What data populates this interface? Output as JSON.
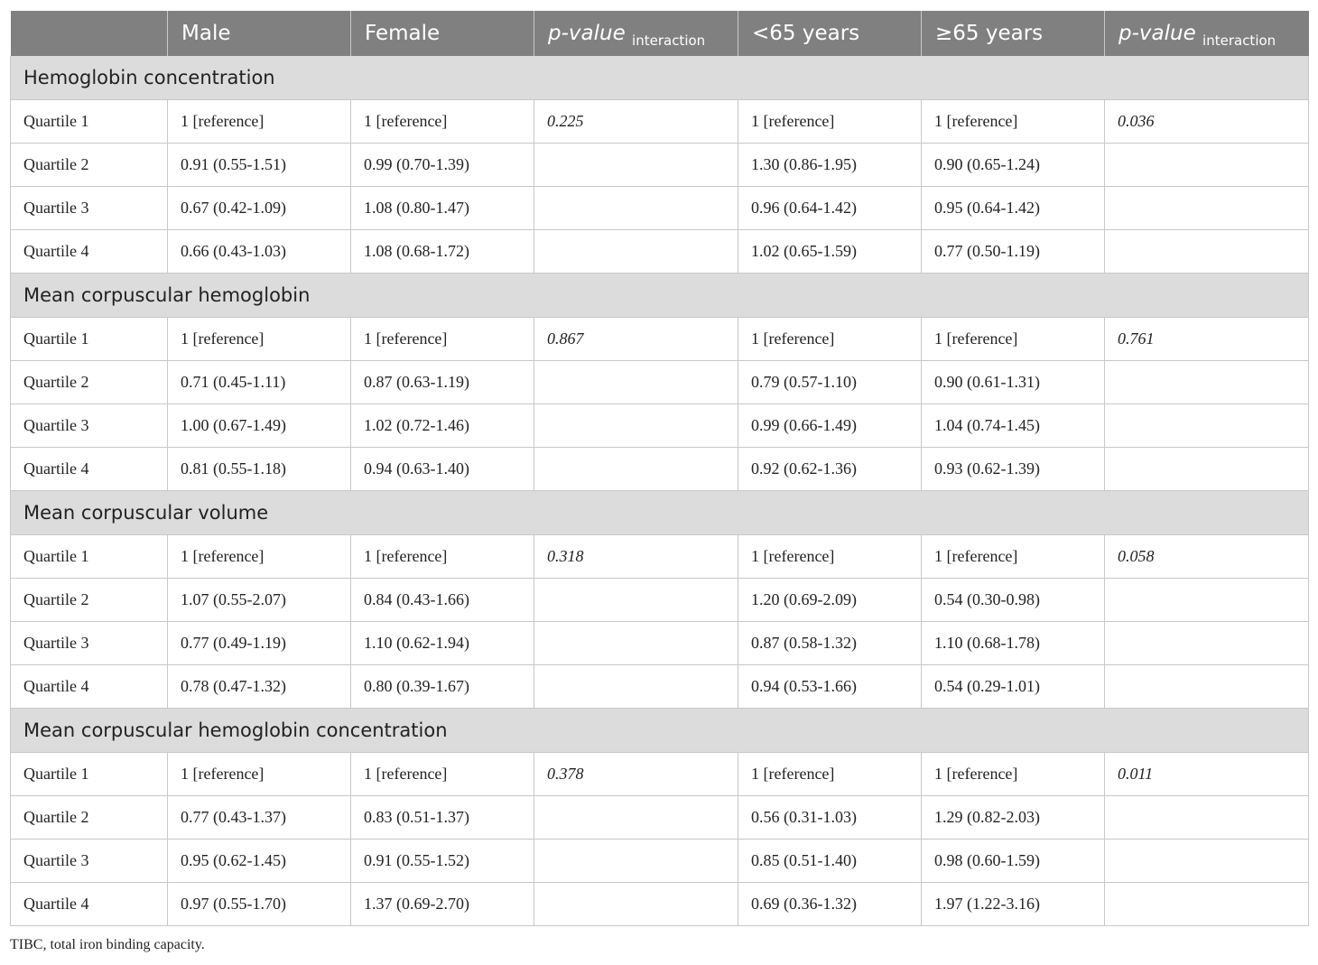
{
  "header": {
    "col0": "",
    "col1": "Male",
    "col2": "Female",
    "col3_main": "p-value",
    "col3_sub": "interaction",
    "col4": "<65 years",
    "col5": "≥65 years",
    "col6_main": "p-value",
    "col6_sub": "interaction"
  },
  "sections": [
    {
      "title": "Hemoglobin concentration",
      "rows": [
        [
          "Quartile 1",
          "1 [reference]",
          "1 [reference]",
          "0.225",
          "1 [reference]",
          "1 [reference]",
          "0.036"
        ],
        [
          "Quartile 2",
          "0.91 (0.55-1.51)",
          "0.99 (0.70-1.39)",
          "",
          "1.30 (0.86-1.95)",
          "0.90 (0.65-1.24)",
          ""
        ],
        [
          "Quartile 3",
          "0.67 (0.42-1.09)",
          "1.08 (0.80-1.47)",
          "",
          "0.96 (0.64-1.42)",
          "0.95 (0.64-1.42)",
          ""
        ],
        [
          "Quartile 4",
          "0.66 (0.43-1.03)",
          "1.08 (0.68-1.72)",
          "",
          "1.02 (0.65-1.59)",
          "0.77 (0.50-1.19)",
          ""
        ]
      ]
    },
    {
      "title": "Mean corpuscular hemoglobin",
      "rows": [
        [
          "Quartile 1",
          "1 [reference]",
          "1 [reference]",
          "0.867",
          "1 [reference]",
          "1 [reference]",
          "0.761"
        ],
        [
          "Quartile 2",
          "0.71 (0.45-1.11)",
          "0.87 (0.63-1.19)",
          "",
          "0.79 (0.57-1.10)",
          "0.90 (0.61-1.31)",
          ""
        ],
        [
          "Quartile 3",
          "1.00 (0.67-1.49)",
          "1.02 (0.72-1.46)",
          "",
          "0.99 (0.66-1.49)",
          "1.04 (0.74-1.45)",
          ""
        ],
        [
          "Quartile 4",
          "0.81 (0.55-1.18)",
          "0.94 (0.63-1.40)",
          "",
          "0.92 (0.62-1.36)",
          "0.93 (0.62-1.39)",
          ""
        ]
      ]
    },
    {
      "title": "Mean corpuscular volume",
      "rows": [
        [
          "Quartile 1",
          "1 [reference]",
          "1 [reference]",
          "0.318",
          "1 [reference]",
          "1 [reference]",
          "0.058"
        ],
        [
          "Quartile 2",
          "1.07 (0.55-2.07)",
          "0.84 (0.43-1.66)",
          "",
          "1.20 (0.69-2.09)",
          "0.54 (0.30-0.98)",
          ""
        ],
        [
          "Quartile 3",
          "0.77 (0.49-1.19)",
          "1.10 (0.62-1.94)",
          "",
          "0.87 (0.58-1.32)",
          "1.10 (0.68-1.78)",
          ""
        ],
        [
          "Quartile 4",
          "0.78 (0.47-1.32)",
          "0.80 (0.39-1.67)",
          "",
          "0.94 (0.53-1.66)",
          "0.54 (0.29-1.01)",
          ""
        ]
      ]
    },
    {
      "title": "Mean corpuscular hemoglobin concentration",
      "rows": [
        [
          "Quartile 1",
          "1 [reference]",
          "1 [reference]",
          "0.378",
          "1 [reference]",
          "1 [reference]",
          "0.011"
        ],
        [
          "Quartile 2",
          "0.77 (0.43-1.37)",
          "0.83 (0.51-1.37)",
          "",
          "0.56 (0.31-1.03)",
          "1.29 (0.82-2.03)",
          ""
        ],
        [
          "Quartile 3",
          "0.95 (0.62-1.45)",
          "0.91 (0.55-1.52)",
          "",
          "0.85 (0.51-1.40)",
          "0.98 (0.60-1.59)",
          ""
        ],
        [
          "Quartile 4",
          "0.97 (0.55-1.70)",
          "1.37 (0.69-2.70)",
          "",
          "0.69 (0.36-1.32)",
          "1.97 (1.22-3.16)",
          ""
        ]
      ]
    }
  ],
  "footnote": "TIBC, total iron binding capacity."
}
